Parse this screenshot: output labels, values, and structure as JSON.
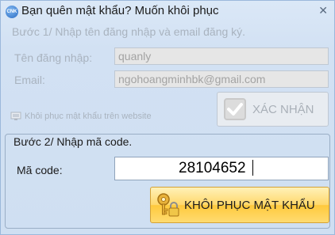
{
  "window": {
    "title": "Bạn quên mật khẩu? Muốn khôi phục",
    "app_icon_text": "CNK",
    "close_glyph": "✕"
  },
  "step1": {
    "heading": "Bước 1/ Nhập tên đăng nhập và email đăng ký.",
    "username_label": "Tên đăng nhập:",
    "username_value": "quanly",
    "email_label": "Email:",
    "email_value": "ngohoangminhbk@gmail.com",
    "confirm_button": "XÁC NHẬN",
    "web_link": "Khôi phục mật khẩu trên website"
  },
  "step2": {
    "heading": "Bước 2/ Nhập mã code.",
    "code_label": "Mã code:",
    "code_value": "28104652",
    "restore_button": "KHÔI PHỤC MẬT KHẨU"
  },
  "icons": {
    "app": "app-logo-icon",
    "close": "close-icon",
    "confirm": "checkmark-icon",
    "web": "web-restore-icon",
    "restore": "key-lock-icon"
  },
  "colors": {
    "window_bg": "#d2e1f3",
    "border": "#9bb8db",
    "disabled_text": "#a9b3bf",
    "restore_button_bg": "#ffd86b"
  }
}
